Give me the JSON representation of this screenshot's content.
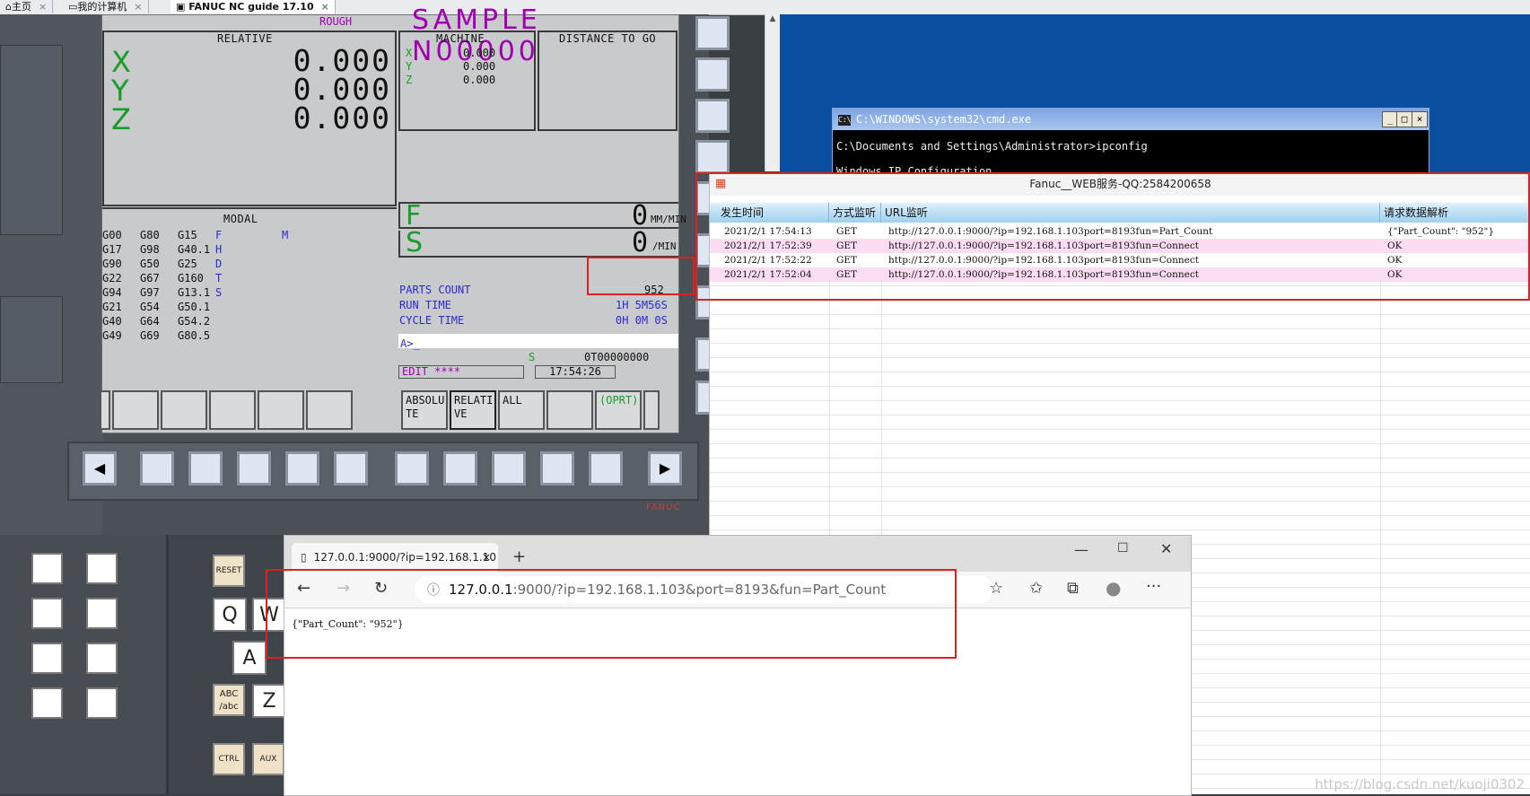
{
  "topbar": {
    "tabs": [
      {
        "label": "主页"
      },
      {
        "label": "我的计算机"
      },
      {
        "label": "FANUC NC guide 17.10"
      }
    ]
  },
  "cnc": {
    "mode_label": "ROUGH",
    "program_title": "SAMPLE N00000",
    "relative": {
      "header": "RELATIVE",
      "axes": [
        "X",
        "Y",
        "Z"
      ],
      "values": [
        "0.000",
        "0.000",
        "0.000"
      ]
    },
    "machine": {
      "header": "MACHINE",
      "axes": [
        "X",
        "Y",
        "Z"
      ],
      "values": [
        "0.000",
        "0.000",
        "0.000"
      ]
    },
    "distance_header": "DISTANCE TO GO",
    "modal": {
      "header": "MODAL",
      "rows": [
        {
          "c1": "G00",
          "c2": "G80",
          "c3": "G15",
          "c4": "F",
          "c5": "M"
        },
        {
          "c1": "G17",
          "c2": "G98",
          "c3": "G40.1",
          "c4": "H",
          "c5": ""
        },
        {
          "c1": "G90",
          "c2": "G50",
          "c3": "G25",
          "c4": "D",
          "c5": ""
        },
        {
          "c1": "G22",
          "c2": "G67",
          "c3": "G160",
          "c4": "T",
          "c5": ""
        },
        {
          "c1": "G94",
          "c2": "G97",
          "c3": "G13.1",
          "c4": "S",
          "c5": ""
        },
        {
          "c1": "G21",
          "c2": "G54",
          "c3": "G50.1",
          "c4": "",
          "c5": ""
        },
        {
          "c1": "G40",
          "c2": "G64",
          "c3": "G54.2",
          "c4": "",
          "c5": ""
        },
        {
          "c1": "G49",
          "c2": "G69",
          "c3": "G80.5",
          "c4": "",
          "c5": ""
        }
      ]
    },
    "feed": {
      "letter": "F",
      "value": "0",
      "unit": "MM/MIN"
    },
    "spindle": {
      "letter": "S",
      "value": "0",
      "unit": "/MIN"
    },
    "parts_count_label": "PARTS COUNT",
    "parts_count_value": "952",
    "run_time_label": "RUN TIME",
    "run_time_value": "1H 5M56S",
    "cycle_time_label": "CYCLE TIME",
    "cycle_time_value": "0H 0M 0S",
    "prompt": "A>_",
    "status_s": "S",
    "status_t": "0T00000000",
    "edit_status": "EDIT ****",
    "clock": "17:54:26",
    "softkeys": [
      "ABSOLU TE",
      "RELATI VE",
      "ALL",
      "",
      "(OPRT)"
    ],
    "brand": "FANUC",
    "keys": {
      "reset": "RESET",
      "q": "Q",
      "w": "W",
      "a": "A",
      "z": "Z",
      "shift": "ABC /abc",
      "ctrl": "CTRL",
      "aux": "AUX"
    }
  },
  "cmd": {
    "title": "C:\\WINDOWS\\system32\\cmd.exe",
    "line1": "C:\\Documents and Settings\\Administrator>ipconfig",
    "line2": "Windows IP Configuration"
  },
  "webservice": {
    "title": "Fanuc__WEB服务-QQ:2584200658",
    "columns": [
      "发生时间",
      "方式监听",
      "URL监听",
      "请求数据解析"
    ],
    "rows": [
      {
        "time": "2021/2/1 17:54:13",
        "method": "GET",
        "url": "http://127.0.0.1:9000/?ip=192.168.1.103port=8193fun=Part_Count",
        "result": "{\"Part_Count\": \"952\"}"
      },
      {
        "time": "2021/2/1 17:52:39",
        "method": "GET",
        "url": "http://127.0.0.1:9000/?ip=192.168.1.103port=8193fun=Connect",
        "result": "OK"
      },
      {
        "time": "2021/2/1 17:52:22",
        "method": "GET",
        "url": "http://127.0.0.1:9000/?ip=192.168.1.103port=8193fun=Connect",
        "result": "OK"
      },
      {
        "time": "2021/2/1 17:52:04",
        "method": "GET",
        "url": "http://127.0.0.1:9000/?ip=192.168.1.103port=8193fun=Connect",
        "result": "OK"
      }
    ],
    "row_colors": [
      "#ffffff",
      "#fbdcf3"
    ]
  },
  "browser": {
    "tab_label": "127.0.0.1:9000/?ip=192.168.1.10",
    "address_host": "127.0.0.1",
    "address_rest": ":9000/?ip=192.168.1.103&port=8193&fun=Part_Count",
    "body_text": "{\"Part_Count\": \"952\"}"
  },
  "watermark": "https://blog.csdn.net/kuoji0302",
  "colors": {
    "highlight": "#e02020",
    "desktop": "#0b4fa0",
    "cnc_green": "#1a9c2a",
    "cnc_blue": "#2a2ad0"
  }
}
